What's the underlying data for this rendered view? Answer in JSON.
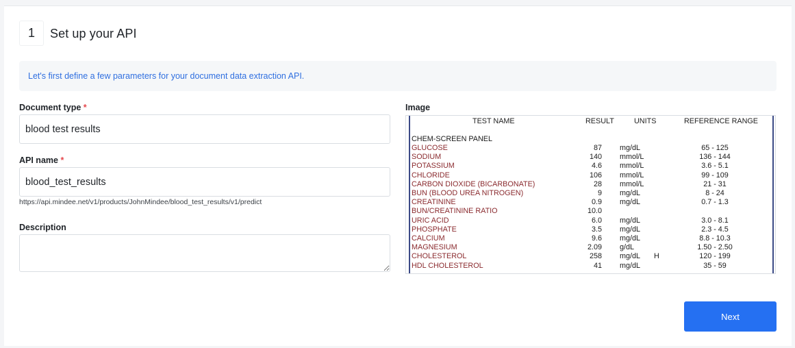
{
  "step": {
    "number": "1",
    "title": "Set up your API"
  },
  "info": {
    "text": "Let's first define a few parameters for your document data extraction API."
  },
  "form": {
    "required_marker": "*",
    "document_type": {
      "label": "Document type",
      "value": "blood test results"
    },
    "api_name": {
      "label": "API name",
      "value": "blood_test_results",
      "url_hint": "https://api.mindee.net/v1/products/JohnMindee/blood_test_results/v1/predict"
    },
    "description": {
      "label": "Description",
      "value": ""
    }
  },
  "image": {
    "label": "Image",
    "header": {
      "test_name": "TEST NAME",
      "result": "RESULT",
      "units": "UNITS",
      "reference_range": "REFERENCE RANGE"
    },
    "panel_title": "CHEM-SCREEN PANEL",
    "rows": [
      {
        "name": "GLUCOSE",
        "result": "87",
        "units": "mg/dL",
        "flag": "",
        "range": "65 - 125"
      },
      {
        "name": "SODIUM",
        "result": "140",
        "units": "mmol/L",
        "flag": "",
        "range": "136 - 144"
      },
      {
        "name": "POTASSIUM",
        "result": "4.6",
        "units": "mmol/L",
        "flag": "",
        "range": "3.6 - 5.1"
      },
      {
        "name": "CHLORIDE",
        "result": "106",
        "units": "mmol/L",
        "flag": "",
        "range": "99 - 109"
      },
      {
        "name": "CARBON DIOXIDE (BICARBONATE)",
        "result": "28",
        "units": "mmol/L",
        "flag": "",
        "range": "21 - 31"
      },
      {
        "name": "BUN (BLOOD UREA NITROGEN)",
        "result": "9",
        "units": "mg/dL",
        "flag": "",
        "range": "8 - 24"
      },
      {
        "name": "CREATININE",
        "result": "0.9",
        "units": "mg/dL",
        "flag": "",
        "range": "0.7 - 1.3"
      },
      {
        "name": "BUN/CREATININE RATIO",
        "result": "10.0",
        "units": "",
        "flag": "",
        "range": ""
      },
      {
        "name": "URIC ACID",
        "result": "6.0",
        "units": "mg/dL",
        "flag": "",
        "range": "3.0 - 8.1"
      },
      {
        "name": "PHOSPHATE",
        "result": "3.5",
        "units": "mg/dL",
        "flag": "",
        "range": "2.3 - 4.5"
      },
      {
        "name": "CALCIUM",
        "result": "9.6",
        "units": "mg/dL",
        "flag": "",
        "range": "8.8 - 10.3"
      },
      {
        "name": "MAGNESIUM",
        "result": "2.09",
        "units": "g/dL",
        "flag": "",
        "range": "1.50 - 2.50"
      },
      {
        "name": "CHOLESTEROL",
        "result": "258",
        "units": "mg/dL",
        "flag": "H",
        "range": "120 - 199"
      },
      {
        "name": "HDL CHOLESTEROL",
        "result": "41",
        "units": "mg/dL",
        "flag": "",
        "range": "35 - 59"
      }
    ]
  },
  "actions": {
    "next_label": "Next"
  },
  "colors": {
    "accent": "#2570f2",
    "info_text": "#2f6fe0",
    "required": "#e5484d",
    "doc_red": "#8a2a2e"
  }
}
